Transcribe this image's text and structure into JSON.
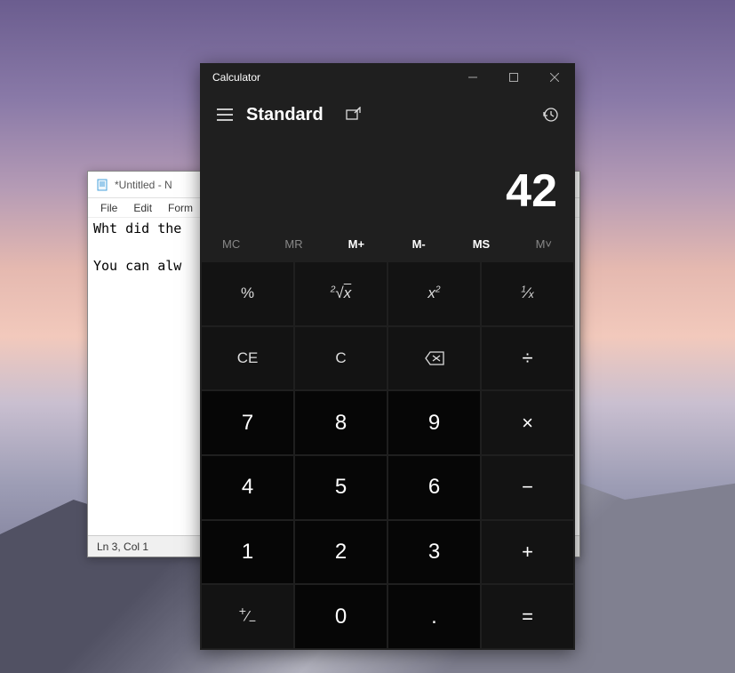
{
  "notepad": {
    "title": "*Untitled - N",
    "menu": {
      "file": "File",
      "edit": "Edit",
      "format": "Form"
    },
    "content": "Wht did the\n\nYou can alw",
    "status": "Ln 3, Col 1"
  },
  "calculator": {
    "title": "Calculator",
    "mode": "Standard",
    "display": "42",
    "memory": {
      "mc": "MC",
      "mr": "MR",
      "mplus": "M+",
      "mminus": "M-",
      "ms": "MS",
      "mlist": "M˅"
    },
    "buttons": {
      "percent": "%",
      "sqrt": "²√x",
      "square": "x²",
      "reciprocal": "¹⁄ₓ",
      "ce": "CE",
      "c": "C",
      "backspace": "⌫",
      "divide": "÷",
      "seven": "7",
      "eight": "8",
      "nine": "9",
      "multiply": "×",
      "four": "4",
      "five": "5",
      "six": "6",
      "minus": "−",
      "one": "1",
      "two": "2",
      "three": "3",
      "plus": "+",
      "negate": "⁺⁄₋",
      "zero": "0",
      "decimal": ".",
      "equals": "="
    }
  }
}
